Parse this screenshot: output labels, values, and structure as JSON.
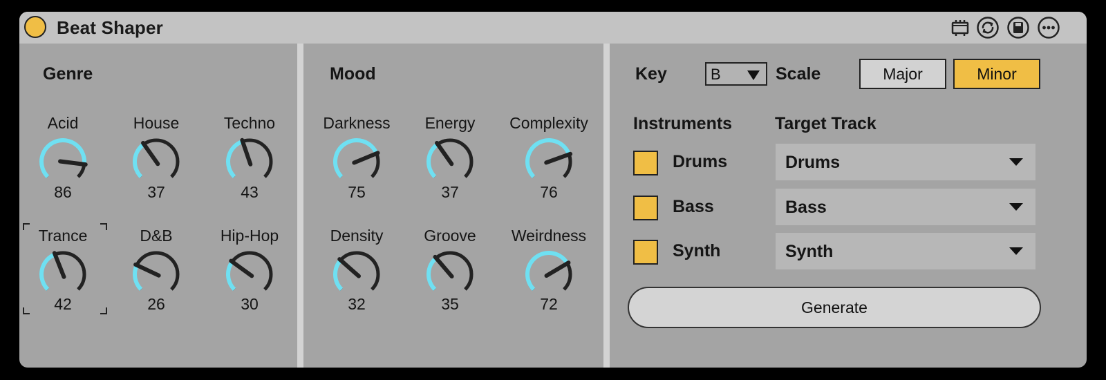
{
  "title": "Beat Shaper",
  "colors": {
    "accent": "#f0be45",
    "knob_arc": "#6fe0f2",
    "panel": "#a4a4a4",
    "titlebar": "#c3c3c3"
  },
  "header_icons": [
    "clip-icon",
    "hot-swap-icon",
    "save-icon",
    "more-icon"
  ],
  "genre": {
    "title": "Genre",
    "knobs": [
      {
        "label": "Acid",
        "value": "86"
      },
      {
        "label": "House",
        "value": "37"
      },
      {
        "label": "Techno",
        "value": "43"
      },
      {
        "label": "Trance",
        "value": "42"
      },
      {
        "label": "D&B",
        "value": "26"
      },
      {
        "label": "Hip-Hop",
        "value": "30"
      }
    ]
  },
  "mood": {
    "title": "Mood",
    "knobs": [
      {
        "label": "Darkness",
        "value": "75"
      },
      {
        "label": "Energy",
        "value": "37"
      },
      {
        "label": "Complexity",
        "value": "76"
      },
      {
        "label": "Density",
        "value": "32"
      },
      {
        "label": "Groove",
        "value": "35"
      },
      {
        "label": "Weirdness",
        "value": "72"
      }
    ]
  },
  "key": {
    "label": "Key",
    "value": "B"
  },
  "scale": {
    "label": "Scale",
    "options": [
      "Major",
      "Minor"
    ],
    "selected": "Minor"
  },
  "instruments": {
    "title": "Instruments",
    "items": [
      {
        "label": "Drums",
        "checked": true
      },
      {
        "label": "Bass",
        "checked": true
      },
      {
        "label": "Synth",
        "checked": true
      }
    ]
  },
  "target_track": {
    "title": "Target Track",
    "items": [
      {
        "value": "Drums"
      },
      {
        "value": "Bass"
      },
      {
        "value": "Synth"
      }
    ]
  },
  "generate_label": "Generate"
}
